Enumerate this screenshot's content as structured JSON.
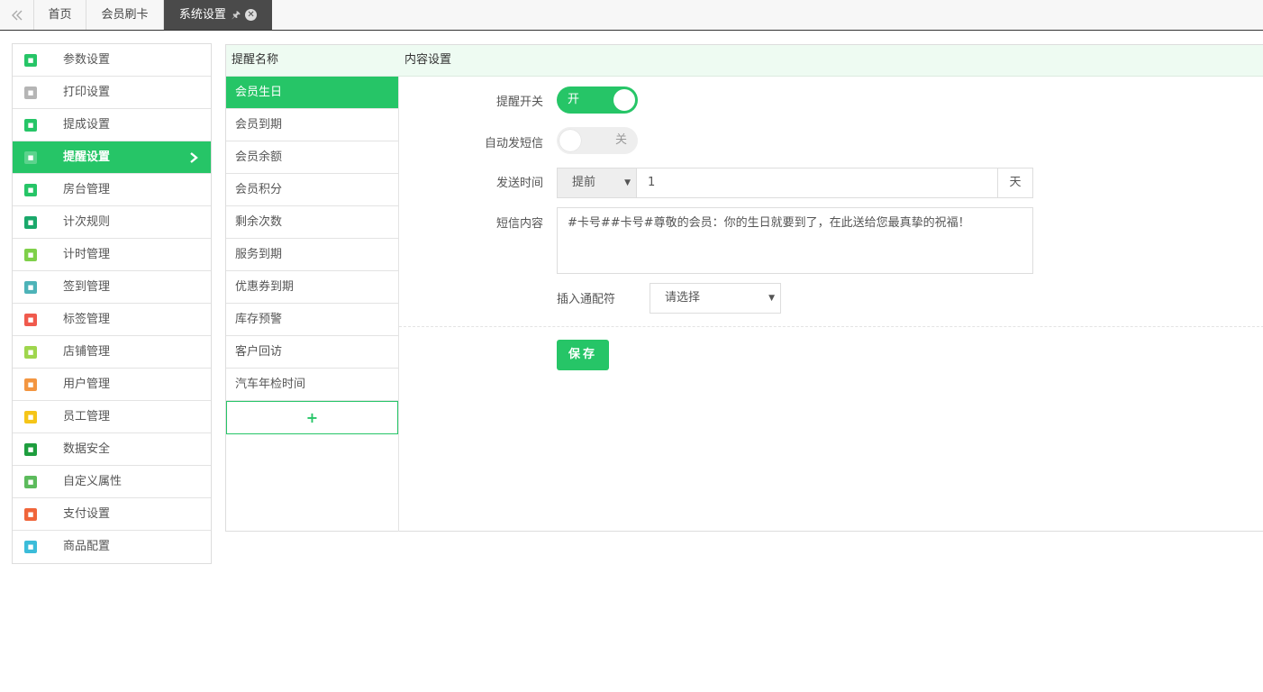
{
  "tabs": {
    "collapse_icon": "double-chevron-left-icon",
    "items": [
      {
        "label": "首页"
      },
      {
        "label": "会员刷卡"
      },
      {
        "label": "系统设置"
      }
    ],
    "pin_icon": "pin-icon",
    "close_icon": "close-icon"
  },
  "menu": {
    "items": [
      {
        "label": "参数设置",
        "icon": "sliders-icon",
        "color": "#26c567"
      },
      {
        "label": "打印设置",
        "icon": "printer-icon",
        "color": "#b5b5b5"
      },
      {
        "label": "提成设置",
        "icon": "commission-icon",
        "color": "#26c567"
      },
      {
        "label": "提醒设置",
        "icon": "bell-icon",
        "color": "#26c567"
      },
      {
        "label": "房台管理",
        "icon": "shield-icon",
        "color": "#26c567"
      },
      {
        "label": "计次规则",
        "icon": "list-icon",
        "color": "#1aa86b"
      },
      {
        "label": "计时管理",
        "icon": "alarm-clock-icon",
        "color": "#7fd04a"
      },
      {
        "label": "签到管理",
        "icon": "calendar-icon",
        "color": "#4db3b8"
      },
      {
        "label": "标签管理",
        "icon": "tag-icon",
        "color": "#f05a4d"
      },
      {
        "label": "店铺管理",
        "icon": "store-icon",
        "color": "#9fd64d"
      },
      {
        "label": "用户管理",
        "icon": "user-icon",
        "color": "#f39641"
      },
      {
        "label": "员工管理",
        "icon": "staff-icon",
        "color": "#f5c518"
      },
      {
        "label": "数据安全",
        "icon": "bar-chart-icon",
        "color": "#1e9e3e"
      },
      {
        "label": "自定义属性",
        "icon": "edit-icon",
        "color": "#5cbb5c"
      },
      {
        "label": "支付设置",
        "icon": "payment-icon",
        "color": "#f0653a"
      },
      {
        "label": "商品配置",
        "icon": "tools-icon",
        "color": "#3bbcd9"
      }
    ],
    "active_index": 3,
    "arrow_icon": "chevron-right-icon"
  },
  "panel": {
    "col_name": "提醒名称",
    "col_content": "内容设置",
    "reminders": [
      "会员生日",
      "会员到期",
      "会员余额",
      "会员积分",
      "剩余次数",
      "服务到期",
      "优惠券到期",
      "库存预警",
      "客户回访",
      "汽车年检时间"
    ],
    "add_label": "+"
  },
  "form": {
    "switch_label": "提醒开关",
    "switch_state": "开",
    "sms_label": "自动发短信",
    "sms_state": "关",
    "time_label": "发送时间",
    "time_mode": "提前",
    "time_value": "1",
    "time_unit": "天",
    "content_label": "短信内容",
    "content_value": "#卡号##卡号#尊敬的会员：你的生日就要到了，在此送给您最真挚的祝福！",
    "wildcard_label": "插入通配符",
    "wildcard_value": "请选择",
    "save_label": "保存"
  },
  "colors": {
    "accent": "#26c567",
    "header_bg": "#eefbf2",
    "active_tab": "#4a4a4a"
  }
}
